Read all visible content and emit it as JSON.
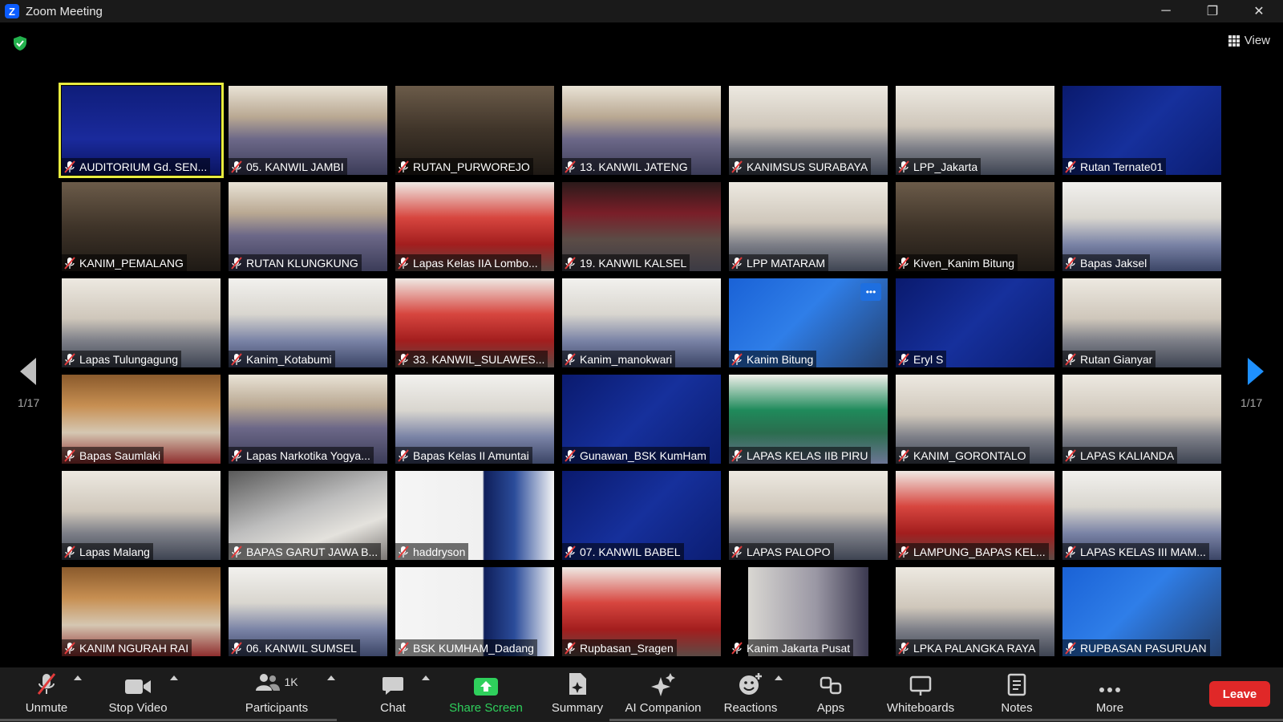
{
  "window": {
    "title": "Zoom Meeting",
    "minimize": "─",
    "restore": "❐",
    "close": "✕"
  },
  "view_label": "View",
  "page_indicator_left": "1/17",
  "page_indicator_right": "1/17",
  "participants": [
    {
      "name": "AUDITORIUM Gd. SEN...",
      "scene": "slide",
      "active": true
    },
    {
      "name": "05. KANWIL JAMBI",
      "scene": "crowd"
    },
    {
      "name": "RUTAN_PURWOREJO",
      "scene": "dark"
    },
    {
      "name": "13. KANWIL JATENG",
      "scene": "crowd"
    },
    {
      "name": "KANIMSUS SURABAYA",
      "scene": "office"
    },
    {
      "name": "LPP_Jakarta",
      "scene": "office"
    },
    {
      "name": "Rutan Ternate01",
      "scene": "webinar"
    },
    {
      "name": "KANIM_PEMALANG",
      "scene": "dark"
    },
    {
      "name": "RUTAN KLUNGKUNG",
      "scene": "crowd"
    },
    {
      "name": "Lapas Kelas IIA Lombo...",
      "scene": "red"
    },
    {
      "name": "19. KANWIL KALSEL",
      "scene": "banner"
    },
    {
      "name": "LPP MATARAM",
      "scene": "office"
    },
    {
      "name": "Kiven_Kanim Bitung",
      "scene": "dark"
    },
    {
      "name": "Bapas Jaksel",
      "scene": "hall"
    },
    {
      "name": "Lapas Tulungagung",
      "scene": "office"
    },
    {
      "name": "Kanim_Kotabumi",
      "scene": "hall"
    },
    {
      "name": "33. KANWIL_SULAWES...",
      "scene": "red"
    },
    {
      "name": "Kanim_manokwari",
      "scene": "hall"
    },
    {
      "name": "Kanim Bitung",
      "scene": "blue",
      "more": true
    },
    {
      "name": "Eryl S",
      "scene": "webinar"
    },
    {
      "name": "Rutan Gianyar",
      "scene": "office"
    },
    {
      "name": "Bapas Saumlaki",
      "scene": "wood"
    },
    {
      "name": "Lapas Narkotika Yogya...",
      "scene": "crowd"
    },
    {
      "name": "Bapas Kelas II Amuntai",
      "scene": "hall"
    },
    {
      "name": "Gunawan_BSK KumHam",
      "scene": "webinar"
    },
    {
      "name": "LAPAS KELAS IIB PIRU",
      "scene": "green"
    },
    {
      "name": "KANIM_GORONTALO",
      "scene": "office"
    },
    {
      "name": "LAPAS KALIANDA",
      "scene": "office"
    },
    {
      "name": "Lapas Malang",
      "scene": "office"
    },
    {
      "name": "BAPAS GARUT JAWA B...",
      "scene": "grey"
    },
    {
      "name": "haddryson",
      "scene": "doc"
    },
    {
      "name": "07. KANWIL BABEL",
      "scene": "webinar"
    },
    {
      "name": "LAPAS PALOPO",
      "scene": "office"
    },
    {
      "name": "LAMPUNG_BAPAS KEL...",
      "scene": "red"
    },
    {
      "name": "LAPAS KELAS III MAM...",
      "scene": "hall"
    },
    {
      "name": "KANIM NGURAH RAI",
      "scene": "wood"
    },
    {
      "name": "06. KANWIL SUMSEL",
      "scene": "hall"
    },
    {
      "name": "BSK KUMHAM_Dadang",
      "scene": "doc"
    },
    {
      "name": "Rupbasan_Sragen",
      "scene": "red"
    },
    {
      "name": "Kanim Jakarta Pusat",
      "scene": "inset"
    },
    {
      "name": "LPKA PALANGKA RAYA",
      "scene": "office"
    },
    {
      "name": "RUPBASAN PASURUAN",
      "scene": "blue"
    }
  ],
  "toolbar": {
    "unmute": "Unmute",
    "stop_video": "Stop Video",
    "participants": "Participants",
    "participant_count": "1K",
    "chat": "Chat",
    "share_screen": "Share Screen",
    "summary": "Summary",
    "ai_companion": "AI Companion",
    "reactions": "Reactions",
    "apps": "Apps",
    "whiteboards": "Whiteboards",
    "notes": "Notes",
    "more": "More",
    "leave": "Leave"
  },
  "colors": {
    "accent": "#0b5cff",
    "active_speaker": "#e8ec3f",
    "leave": "#e02828",
    "share": "#2fd05c",
    "muted": "#e23b3b"
  }
}
